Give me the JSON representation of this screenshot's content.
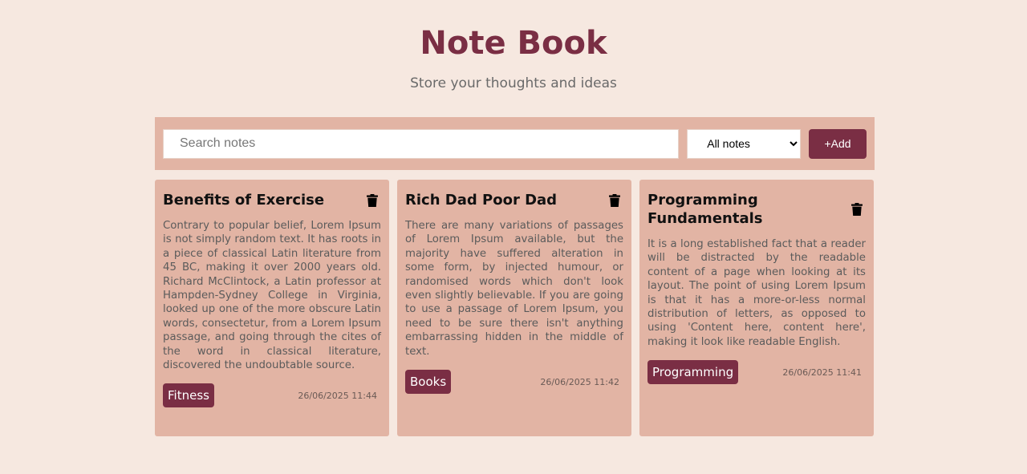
{
  "header": {
    "title": "Note Book",
    "subtitle": "Store your thoughts and ideas"
  },
  "toolbar": {
    "search_placeholder": "Search notes",
    "filter_selected": "All notes",
    "add_label": "+Add"
  },
  "colors": {
    "accent": "#7a2e44",
    "card": "#e2b4a4",
    "background": "#f6e8e0"
  },
  "notes": [
    {
      "title": "Benefits of Exercise",
      "body": "Contrary to popular belief, Lorem Ipsum is not simply random text. It has roots in a piece of classical Latin literature from 45 BC, making it over 2000 years old. Richard McClintock, a Latin professor at Hampden-Sydney College in Virginia, looked up one of the more obscure Latin words, consectetur, from a Lorem Ipsum passage, and going through the cites of the word in classical literature, discovered the undoubtable source.",
      "tag": "Fitness",
      "date": "26/06/2025 11:44",
      "icon": "trash-icon"
    },
    {
      "title": "Rich Dad Poor Dad",
      "body": "There are many variations of passages of Lorem Ipsum available, but the majority have suffered alteration in some form, by injected humour, or randomised words which don't look even slightly believable. If you are going to use a passage of Lorem Ipsum, you need to be sure there isn't anything embarrassing hidden in the middle of text.",
      "tag": "Books",
      "date": "26/06/2025 11:42",
      "icon": "trash-icon"
    },
    {
      "title": "Programming Fundamentals",
      "body": "It is a long established fact that a reader will be distracted by the readable content of a page when looking at its layout. The point of using Lorem Ipsum is that it has a more-or-less normal distribution of letters, as opposed to using 'Content here, content here', making it look like readable English.",
      "tag": "Programming",
      "date": "26/06/2025 11:41",
      "icon": "trash-icon"
    }
  ]
}
